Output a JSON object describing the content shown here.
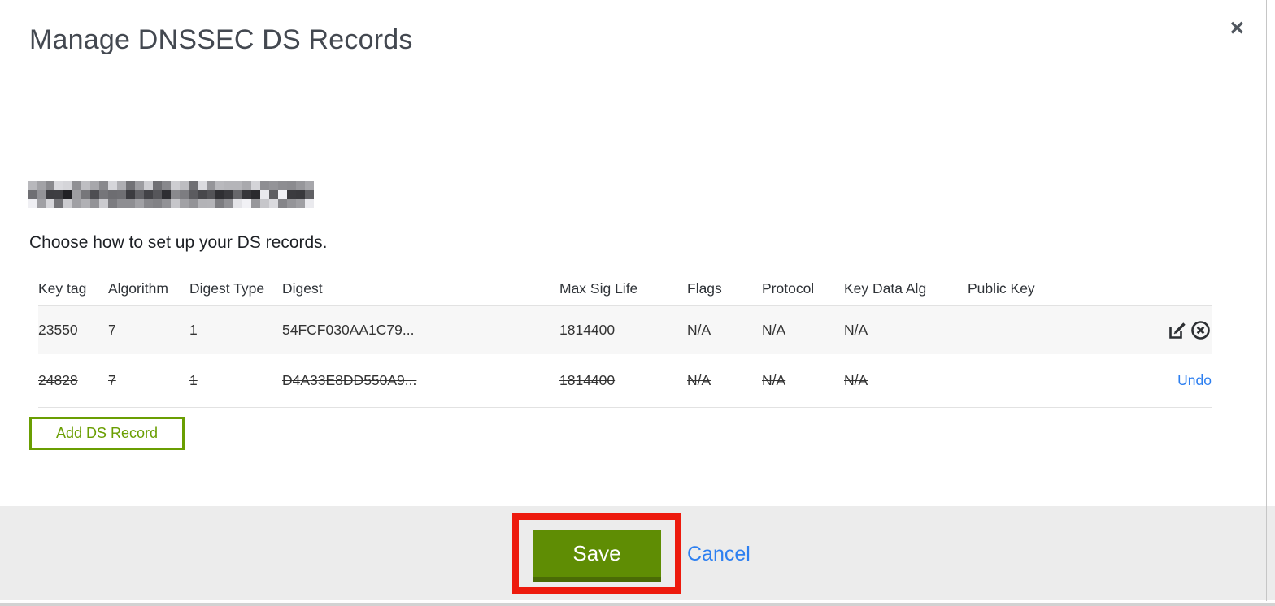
{
  "modal": {
    "title": "Manage DNSSEC DS Records",
    "close_glyph": "×",
    "subtitle": "Choose how to set up your DS records.",
    "table": {
      "columns": [
        "Key tag",
        "Algorithm",
        "Digest Type",
        "Digest",
        "Max Sig Life",
        "Flags",
        "Protocol",
        "Key Data Alg",
        "Public Key"
      ],
      "rows": [
        {
          "key_tag": "23550",
          "algorithm": "7",
          "digest_type": "1",
          "digest": "54FCF030AA1C79...",
          "max_sig_life": "1814400",
          "flags": "N/A",
          "protocol": "N/A",
          "key_data_alg": "N/A",
          "public_key": "",
          "deleted": false,
          "actions": [
            "edit",
            "delete"
          ]
        },
        {
          "key_tag": "24828",
          "algorithm": "7",
          "digest_type": "1",
          "digest": "D4A33E8DD550A9...",
          "max_sig_life": "1814400",
          "flags": "N/A",
          "protocol": "N/A",
          "key_data_alg": "N/A",
          "public_key": "",
          "deleted": true,
          "actions": [
            "undo"
          ],
          "undo_label": "Undo"
        }
      ]
    },
    "add_button_label": "Add DS Record",
    "footer": {
      "save_label": "Save",
      "cancel_label": "Cancel"
    }
  },
  "annotation": {
    "type": "red-highlight-rectangle",
    "target": "save-button",
    "color": "#ed1a0d"
  },
  "colors": {
    "accent_green": "#5f8d04",
    "green_border_dark": "#4a6b06",
    "outline_green": "#6a9e02",
    "link_blue": "#2d7ff0",
    "footer_gray": "#ececec",
    "row_stripe": "#f7f7f7",
    "annotation_red": "#ed1a0d"
  }
}
